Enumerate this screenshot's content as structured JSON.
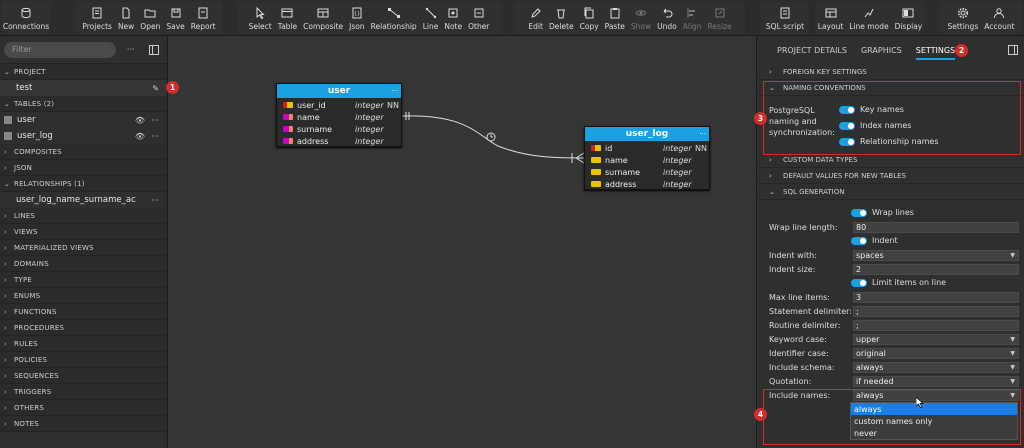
{
  "toolbar": {
    "groups": [
      [
        {
          "label": "Connections",
          "icon": "database-icon"
        }
      ],
      [
        {
          "label": "Projects",
          "icon": "projects-icon"
        },
        {
          "label": "New",
          "icon": "new-file-icon"
        },
        {
          "label": "Open",
          "icon": "folder-open-icon"
        },
        {
          "label": "Save",
          "icon": "save-icon"
        },
        {
          "label": "Report",
          "icon": "report-icon"
        }
      ],
      [
        {
          "label": "Select",
          "icon": "cursor-icon"
        },
        {
          "label": "Table",
          "icon": "table-icon"
        },
        {
          "label": "Composite",
          "icon": "composite-icon"
        },
        {
          "label": "Json",
          "icon": "json-icon"
        },
        {
          "label": "Relationship",
          "icon": "relationship-icon"
        },
        {
          "label": "Line",
          "icon": "line-icon"
        },
        {
          "label": "Note",
          "icon": "note-icon"
        },
        {
          "label": "Other",
          "icon": "other-icon"
        }
      ],
      [
        {
          "label": "Edit",
          "icon": "edit-icon"
        },
        {
          "label": "Delete",
          "icon": "trash-icon"
        },
        {
          "label": "Copy",
          "icon": "copy-icon"
        },
        {
          "label": "Paste",
          "icon": "paste-icon"
        },
        {
          "label": "Show",
          "icon": "eye-icon",
          "disabled": true
        },
        {
          "label": "Undo",
          "icon": "undo-icon"
        },
        {
          "label": "Align",
          "icon": "align-icon",
          "disabled": true
        },
        {
          "label": "Resize",
          "icon": "resize-icon",
          "disabled": true
        }
      ],
      [
        {
          "label": "SQL script",
          "icon": "sql-script-icon"
        }
      ],
      [
        {
          "label": "Layout",
          "icon": "layout-icon"
        },
        {
          "label": "Line mode",
          "icon": "line-mode-icon"
        },
        {
          "label": "Display",
          "icon": "display-icon"
        }
      ],
      [
        {
          "label": "Settings",
          "icon": "gear-icon"
        },
        {
          "label": "Account",
          "icon": "account-icon"
        }
      ]
    ]
  },
  "sidebar": {
    "filter_placeholder": "Filter",
    "sections": [
      {
        "title": "PROJECT",
        "expanded": true,
        "items": [
          {
            "label": "test",
            "edit": true
          }
        ]
      },
      {
        "title": "TABLES  (2)",
        "expanded": true,
        "items": [
          {
            "label": "user",
            "square": true
          },
          {
            "label": "user_log",
            "square": true
          }
        ]
      },
      {
        "title": "COMPOSITES"
      },
      {
        "title": "JSON"
      },
      {
        "title": "RELATIONSHIPS  (1)",
        "expanded": true,
        "items": [
          {
            "label": "user_log_name_surname_ac",
            "more": true
          }
        ]
      },
      {
        "title": "LINES"
      },
      {
        "title": "VIEWS"
      },
      {
        "title": "MATERIALIZED VIEWS"
      },
      {
        "title": "DOMAINS"
      },
      {
        "title": "TYPE"
      },
      {
        "title": "ENUMS"
      },
      {
        "title": "FUNCTIONS"
      },
      {
        "title": "PROCEDURES"
      },
      {
        "title": "RULES"
      },
      {
        "title": "POLICIES"
      },
      {
        "title": "SEQUENCES"
      },
      {
        "title": "TRIGGERS"
      },
      {
        "title": "OTHERS"
      },
      {
        "title": "NOTES"
      }
    ]
  },
  "diagram": {
    "tables": [
      {
        "name": "user",
        "columns": [
          {
            "name": "user_id",
            "type": "integer",
            "nn": "NN",
            "key": "pk"
          },
          {
            "name": "name",
            "type": "integer",
            "nn": "",
            "key": "idx"
          },
          {
            "name": "surname",
            "type": "integer",
            "nn": "",
            "key": "idx"
          },
          {
            "name": "address",
            "type": "integer",
            "nn": "",
            "key": "idx"
          }
        ]
      },
      {
        "name": "user_log",
        "columns": [
          {
            "name": "id",
            "type": "integer",
            "nn": "NN",
            "key": "pk"
          },
          {
            "name": "name",
            "type": "integer",
            "nn": "",
            "key": "fk"
          },
          {
            "name": "surname",
            "type": "integer",
            "nn": "",
            "key": "fk"
          },
          {
            "name": "address",
            "type": "integer",
            "nn": "",
            "key": "fk"
          }
        ]
      }
    ],
    "more_glyph": "···"
  },
  "panel": {
    "tabs": [
      "PROJECT DETAILS",
      "GRAPHICS",
      "SETTINGS"
    ],
    "active_tab": "SETTINGS",
    "sections": {
      "foreign_key": "FOREIGN KEY SETTINGS",
      "naming": "NAMING CONVENTIONS",
      "custom_types": "CUSTOM DATA TYPES",
      "defaults": "DEFAULT VALUES FOR NEW TABLES",
      "sql_gen": "SQL GENERATION"
    },
    "naming_label": "PostgreSQL naming and synchronization:",
    "naming_toggles": [
      "Key names",
      "Index names",
      "Relationship names"
    ],
    "sql": {
      "wrap_lines": "Wrap lines",
      "wrap_line_length_label": "Wrap line length:",
      "wrap_line_length": "80",
      "indent": "Indent",
      "indent_with_label": "Indent with:",
      "indent_with": "spaces",
      "indent_size_label": "Indent size:",
      "indent_size": "2",
      "limit_items": "Limit items on line",
      "max_line_items_label": "Max line items:",
      "max_line_items": "3",
      "statement_delim_label": "Statement delimiter:",
      "statement_delim": ";",
      "routine_delim_label": "Routine delimiter:",
      "routine_delim": ";",
      "keyword_case_label": "Keyword case:",
      "keyword_case": "upper",
      "identifier_case_label": "Identifier case:",
      "identifier_case": "original",
      "include_schema_label": "Include schema:",
      "include_schema": "always",
      "quotation_label": "Quotation:",
      "quotation": "if needed",
      "include_names_label": "Include names:",
      "include_names": "always",
      "include_names_options": [
        "always",
        "custom names only",
        "never"
      ]
    }
  },
  "annotations": [
    "1",
    "2",
    "3",
    "4"
  ],
  "colors": {
    "accent": "#1ba1e2",
    "highlight": "#d42b2b",
    "pk": "#e8c300",
    "fk": "#c800c8"
  }
}
